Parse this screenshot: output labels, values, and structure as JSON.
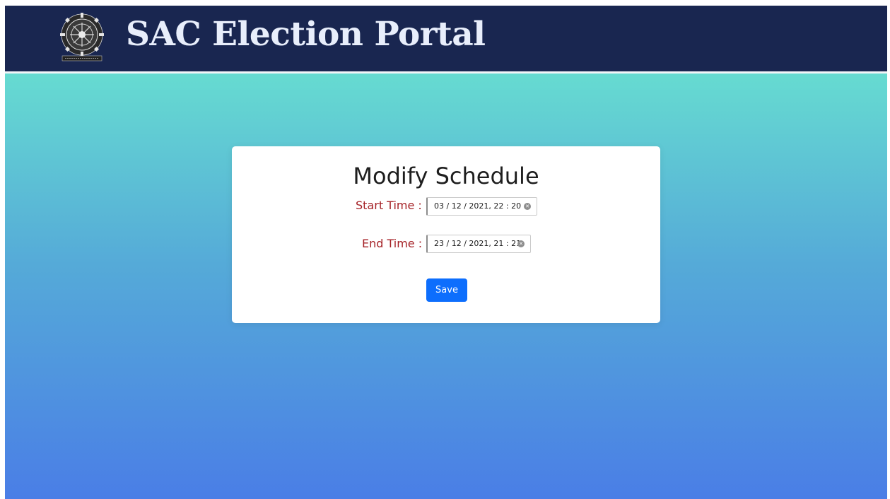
{
  "header": {
    "title": "SAC Election Portal",
    "background": "#192650",
    "logo_icon": "institute-emblem-icon"
  },
  "form": {
    "heading": "Modify Schedule",
    "start": {
      "label": "Start Time :",
      "value": "03 / 12 / 2021,  22 : 20"
    },
    "end": {
      "label": "End Time :",
      "value": "23 / 12 / 2021,  21 : 21"
    },
    "save_label": "Save",
    "label_color": "#a41f24",
    "button_color": "#0d6efd"
  },
  "background_gradient": [
    "#66dbd1",
    "#55aad8",
    "#4a7ee6"
  ]
}
